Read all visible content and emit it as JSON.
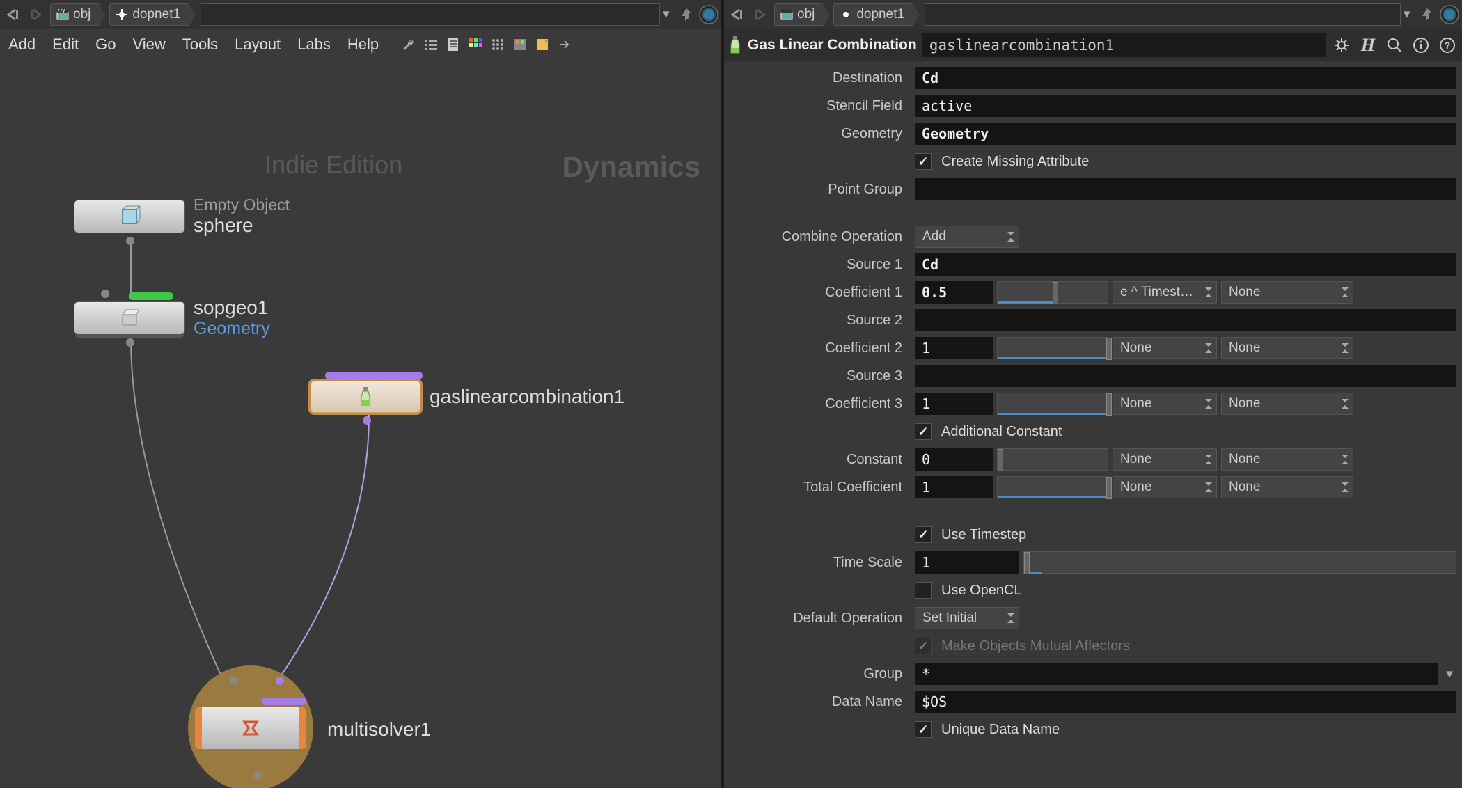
{
  "breadcrumb_left": {
    "root": "obj",
    "current": "dopnet1"
  },
  "breadcrumb_right": {
    "root": "obj",
    "current": "dopnet1"
  },
  "menu": [
    "Add",
    "Edit",
    "Go",
    "View",
    "Tools",
    "Layout",
    "Labs",
    "Help"
  ],
  "watermark_left": "Indie Edition",
  "watermark_right": "Dynamics",
  "nodes": {
    "sphere": {
      "sub": "Empty Object",
      "name": "sphere"
    },
    "sopgeo": {
      "name": "sopgeo1",
      "link": "Geometry"
    },
    "gaslin": {
      "name": "gaslinearcombination1"
    },
    "multisolver": {
      "name": "multisolver1"
    }
  },
  "param_header": {
    "type_label": "Gas Linear Combination",
    "name": "gaslinearcombination1"
  },
  "params": {
    "destination": {
      "label": "Destination",
      "value": "Cd"
    },
    "stencil_field": {
      "label": "Stencil Field",
      "value": "active"
    },
    "geometry": {
      "label": "Geometry",
      "value": "Geometry"
    },
    "create_missing": {
      "label": "Create Missing Attribute",
      "checked": true
    },
    "point_group": {
      "label": "Point Group",
      "value": ""
    },
    "combine_op": {
      "label": "Combine Operation",
      "value": "Add"
    },
    "source1": {
      "label": "Source 1",
      "value": "Cd"
    },
    "coeff1": {
      "label": "Coefficient 1",
      "value": "0.5",
      "dd1": "e ^ Timest…",
      "dd2": "None"
    },
    "source2": {
      "label": "Source 2",
      "value": ""
    },
    "coeff2": {
      "label": "Coefficient 2",
      "value": "1",
      "dd1": "None",
      "dd2": "None"
    },
    "source3": {
      "label": "Source 3",
      "value": ""
    },
    "coeff3": {
      "label": "Coefficient 3",
      "value": "1",
      "dd1": "None",
      "dd2": "None"
    },
    "additional_const": {
      "label": "Additional Constant",
      "checked": true
    },
    "constant": {
      "label": "Constant",
      "value": "0",
      "dd1": "None",
      "dd2": "None"
    },
    "total_coeff": {
      "label": "Total Coefficient",
      "value": "1",
      "dd1": "None",
      "dd2": "None"
    },
    "use_timestep": {
      "label": "Use Timestep",
      "checked": true
    },
    "time_scale": {
      "label": "Time Scale",
      "value": "1"
    },
    "use_opencl": {
      "label": "Use OpenCL",
      "checked": false
    },
    "default_op": {
      "label": "Default Operation",
      "value": "Set Initial"
    },
    "mutual_affectors": {
      "label": "Make Objects Mutual Affectors",
      "checked": true
    },
    "group": {
      "label": "Group",
      "value": "*"
    },
    "data_name": {
      "label": "Data Name",
      "value": "$OS"
    },
    "unique_data_name": {
      "label": "Unique Data Name",
      "checked": true
    }
  }
}
